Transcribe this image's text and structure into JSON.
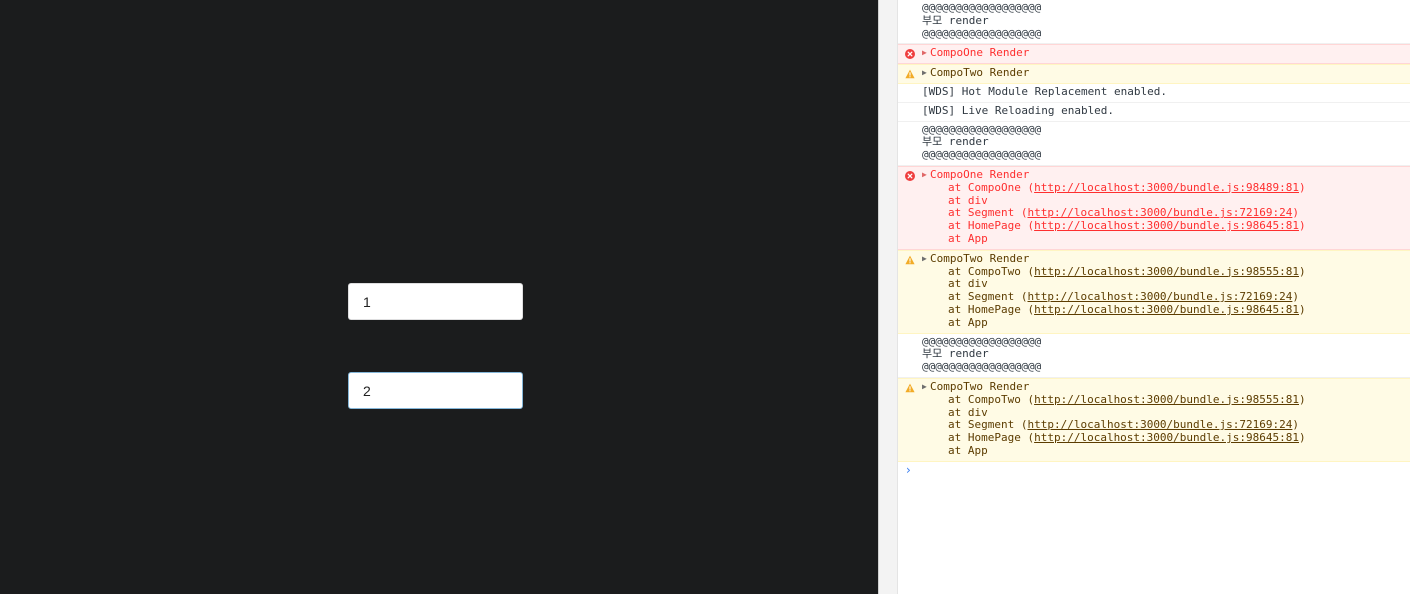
{
  "app": {
    "input_one_value": "1",
    "input_two_value": "2"
  },
  "console": {
    "messages": [
      {
        "level": "log",
        "lines": [
          "@@@@@@@@@@@@@@@@@@",
          "부모 render",
          "@@@@@@@@@@@@@@@@@@"
        ]
      },
      {
        "level": "error",
        "title": "CompoOne Render"
      },
      {
        "level": "warning",
        "title": "CompoTwo Render"
      },
      {
        "level": "log",
        "lines": [
          "[WDS] Hot Module Replacement enabled."
        ]
      },
      {
        "level": "log",
        "lines": [
          "[WDS] Live Reloading enabled."
        ]
      },
      {
        "level": "log",
        "lines": [
          "@@@@@@@@@@@@@@@@@@",
          "부모 render",
          "@@@@@@@@@@@@@@@@@@"
        ]
      },
      {
        "level": "error",
        "title": "CompoOne Render",
        "stack": [
          {
            "pre": "at CompoOne (",
            "link": "http://localhost:3000/bundle.js:98489:81",
            "post": ")"
          },
          {
            "pre": "at div"
          },
          {
            "pre": "at Segment (",
            "link": "http://localhost:3000/bundle.js:72169:24",
            "post": ")"
          },
          {
            "pre": "at HomePage (",
            "link": "http://localhost:3000/bundle.js:98645:81",
            "post": ")"
          },
          {
            "pre": "at App"
          }
        ]
      },
      {
        "level": "warning",
        "title": "CompoTwo Render",
        "stack": [
          {
            "pre": "at CompoTwo (",
            "link": "http://localhost:3000/bundle.js:98555:81",
            "post": ")"
          },
          {
            "pre": "at div"
          },
          {
            "pre": "at Segment (",
            "link": "http://localhost:3000/bundle.js:72169:24",
            "post": ")"
          },
          {
            "pre": "at HomePage (",
            "link": "http://localhost:3000/bundle.js:98645:81",
            "post": ")"
          },
          {
            "pre": "at App"
          }
        ]
      },
      {
        "level": "log",
        "lines": [
          "@@@@@@@@@@@@@@@@@@",
          "부모 render",
          "@@@@@@@@@@@@@@@@@@"
        ]
      },
      {
        "level": "warning",
        "title": "CompoTwo Render",
        "stack": [
          {
            "pre": "at CompoTwo (",
            "link": "http://localhost:3000/bundle.js:98555:81",
            "post": ")"
          },
          {
            "pre": "at div"
          },
          {
            "pre": "at Segment (",
            "link": "http://localhost:3000/bundle.js:72169:24",
            "post": ")"
          },
          {
            "pre": "at HomePage (",
            "link": "http://localhost:3000/bundle.js:98645:81",
            "post": ")"
          },
          {
            "pre": "at App"
          }
        ]
      }
    ],
    "prompt_glyph": "›"
  },
  "colors": {
    "app_bg": "#1b1c1d",
    "error_text": "#fe2f2f",
    "error_bg": "#fff0f0",
    "warning_bg": "#fffbe5",
    "warning_text": "#5c3c00",
    "prompt_blue": "#367cf1"
  },
  "icons": {
    "error": "error-circle-icon",
    "warning": "warning-triangle-icon",
    "expand": "expand-triangle-icon",
    "prompt": "console-prompt-icon"
  }
}
